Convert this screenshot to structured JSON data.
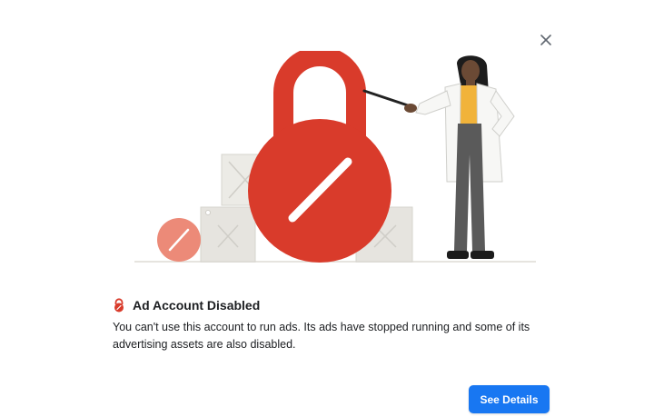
{
  "dialog": {
    "close_icon": "close-icon",
    "illustration_icon": "disabled-lock-illustration",
    "title_icon": "lock-icon",
    "title": "Ad Account Disabled",
    "message": "You can't use this account to run ads. Its ads have stopped running and some of its advertising assets are also disabled.",
    "primary_button": "See Details"
  },
  "colors": {
    "accent": "#1877f2",
    "lock_red": "#d93b2b",
    "lock_pink": "#ec8a78",
    "box_gray": "#e3e1dc",
    "text": "#1c1e21"
  }
}
